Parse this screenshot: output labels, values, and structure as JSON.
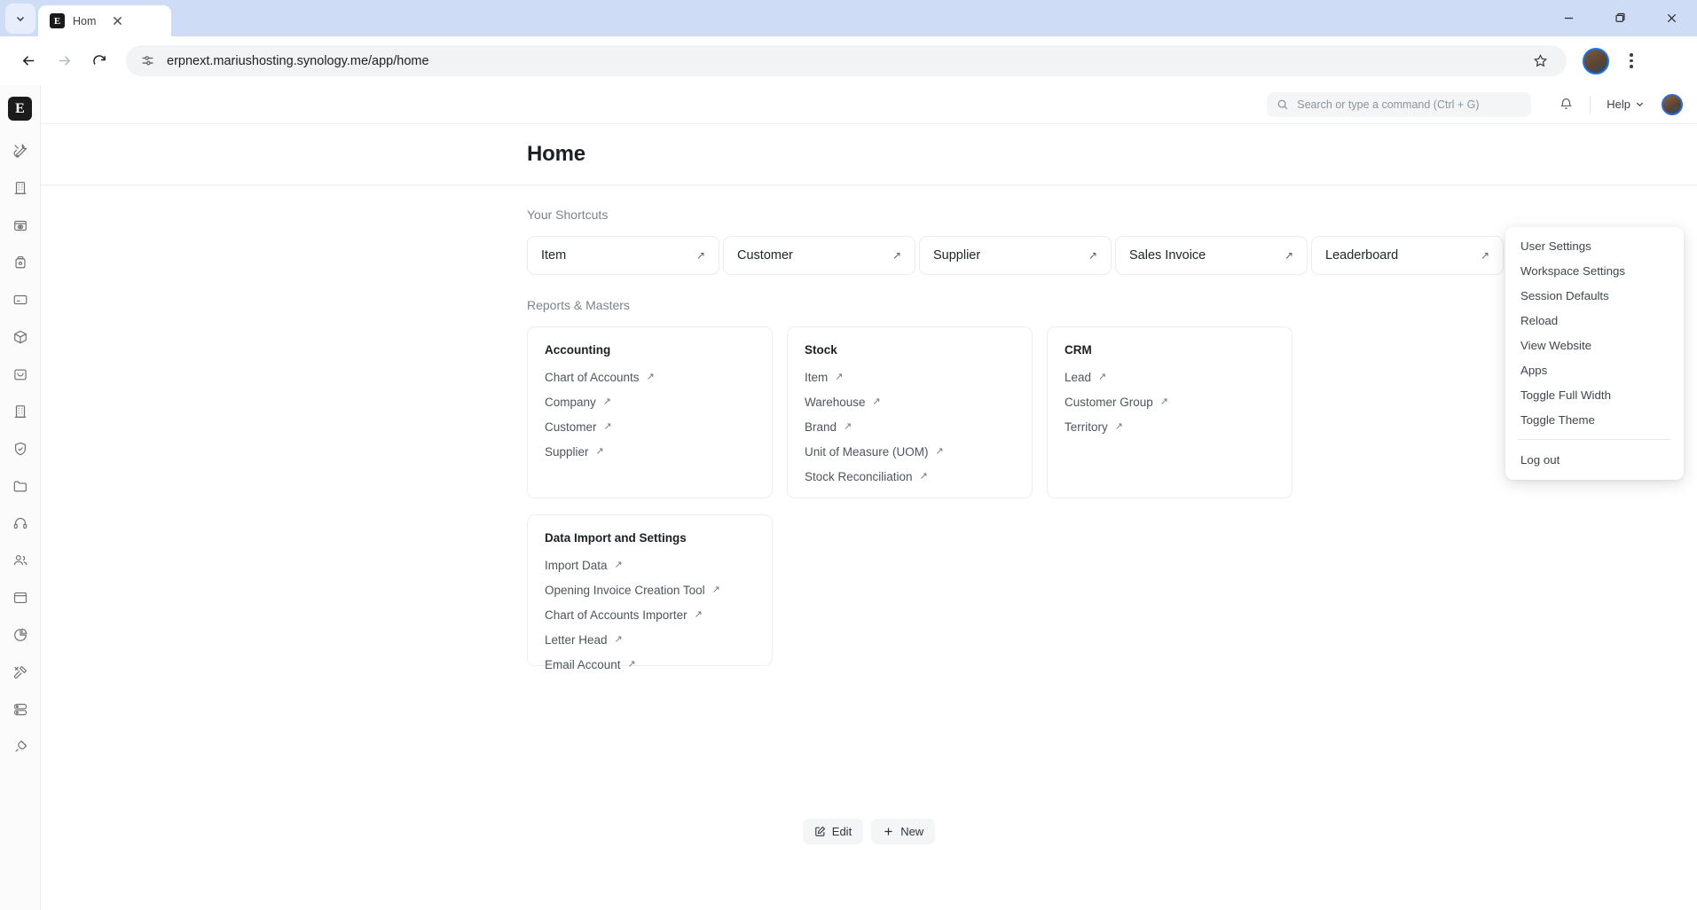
{
  "browser": {
    "tab": {
      "title": "Hom",
      "favicon_icon": "erpnext-logo-icon",
      "close_icon": "close-icon"
    },
    "tabstrip_chevron_icon": "chevron-down-icon",
    "window_controls": {
      "minimize_icon": "minimize-icon",
      "maximize_icon": "maximize-icon",
      "close_icon": "window-close-icon"
    },
    "nav": {
      "back_icon": "back-arrow-icon",
      "forward_icon": "forward-arrow-icon",
      "reload_icon": "reload-icon"
    },
    "omnibox": {
      "site_info_icon": "site-settings-icon",
      "url": "erpnext.mariushosting.synology.me/app/home",
      "bookmark_icon": "star-icon"
    },
    "profile_icon": "browser-profile-avatar",
    "menu_icon": "kebab-menu-icon"
  },
  "rail": {
    "logo": "E",
    "items": [
      {
        "name": "tools-icon"
      },
      {
        "name": "building-icon"
      },
      {
        "name": "archive-eye-icon"
      },
      {
        "name": "jar-icon"
      },
      {
        "name": "card-icon"
      },
      {
        "name": "box-icon"
      },
      {
        "name": "bag-icon"
      },
      {
        "name": "building-alt-icon"
      },
      {
        "name": "shield-check-icon"
      },
      {
        "name": "folder-icon"
      },
      {
        "name": "headset-icon"
      },
      {
        "name": "people-icon"
      },
      {
        "name": "window-icon"
      },
      {
        "name": "pie-chart-icon"
      },
      {
        "name": "hammer-tools-icon"
      },
      {
        "name": "server-icon"
      },
      {
        "name": "plug-icon"
      }
    ]
  },
  "navbar": {
    "search": {
      "icon": "search-icon",
      "placeholder": "Search or type a command (Ctrl + G)"
    },
    "notifications_icon": "bell-icon",
    "help_label": "Help",
    "help_chevron_icon": "chevron-down-icon",
    "avatar_icon": "user-avatar"
  },
  "page": {
    "title": "Home",
    "shortcuts_label": "Your Shortcuts",
    "shortcuts": [
      {
        "label": "Item"
      },
      {
        "label": "Customer"
      },
      {
        "label": "Supplier"
      },
      {
        "label": "Sales Invoice"
      },
      {
        "label": "Leaderboard"
      }
    ],
    "masters_label": "Reports & Masters",
    "cards": [
      {
        "title": "Accounting",
        "links": [
          {
            "label": "Chart of Accounts"
          },
          {
            "label": "Company"
          },
          {
            "label": "Customer"
          },
          {
            "label": "Supplier"
          }
        ]
      },
      {
        "title": "Stock",
        "links": [
          {
            "label": "Item"
          },
          {
            "label": "Warehouse"
          },
          {
            "label": "Brand"
          },
          {
            "label": "Unit of Measure (UOM)"
          },
          {
            "label": "Stock Reconciliation"
          }
        ]
      },
      {
        "title": "CRM",
        "links": [
          {
            "label": "Lead"
          },
          {
            "label": "Customer Group"
          },
          {
            "label": "Territory"
          }
        ]
      },
      {
        "title": "Data Import and Settings",
        "links": [
          {
            "label": "Import Data"
          },
          {
            "label": "Opening Invoice Creation Tool"
          },
          {
            "label": "Chart of Accounts Importer"
          },
          {
            "label": "Letter Head"
          },
          {
            "label": "Email Account"
          }
        ]
      }
    ],
    "arrow_icon": "arrow-up-right-icon",
    "actions": {
      "edit_label": "Edit",
      "edit_icon": "edit-icon",
      "new_label": "New",
      "new_icon": "plus-icon"
    }
  },
  "user_dropdown": {
    "items": [
      {
        "label": "User Settings"
      },
      {
        "label": "Workspace Settings"
      },
      {
        "label": "Session Defaults"
      },
      {
        "label": "Reload"
      },
      {
        "label": "View Website"
      },
      {
        "label": "Apps"
      },
      {
        "label": "Toggle Full Width"
      },
      {
        "label": "Toggle Theme"
      }
    ],
    "logout_label": "Log out"
  },
  "colors": {
    "chrome_tabstrip": "#cfdcf6",
    "accent_blue": "#1a73e8",
    "text_primary": "#1c1f23",
    "text_muted": "#7c838c"
  }
}
